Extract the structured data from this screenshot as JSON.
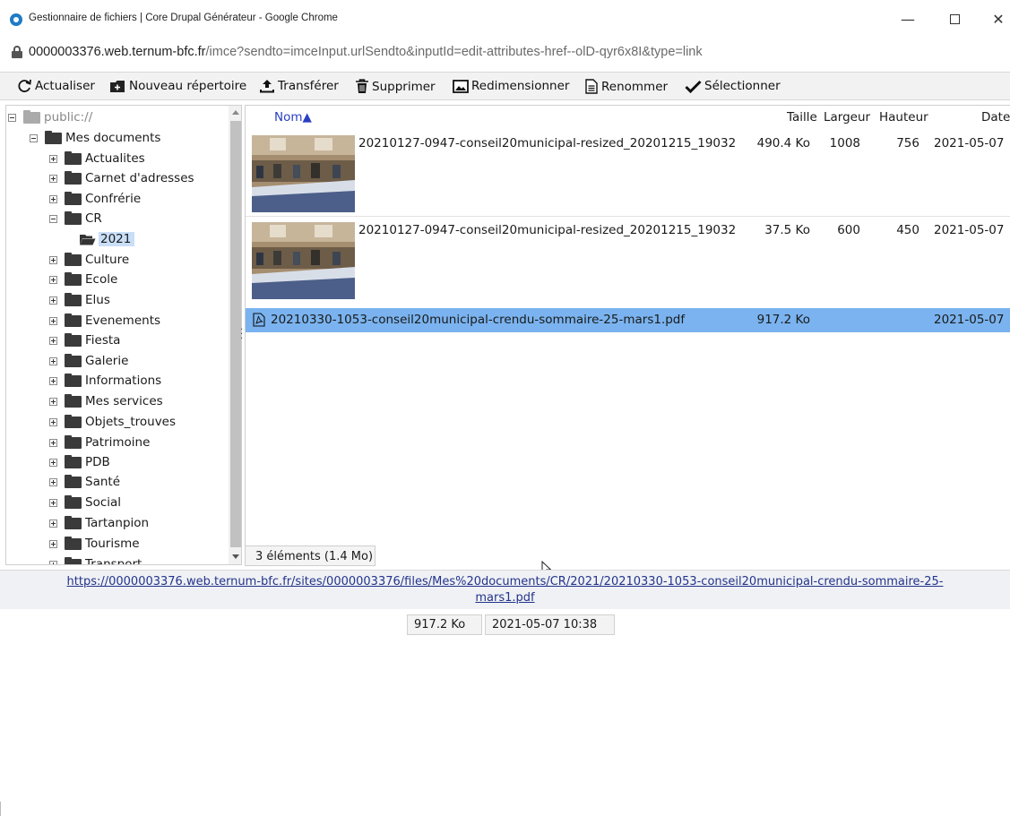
{
  "window": {
    "title": "Gestionnaire de fichiers | Core Drupal Générateur - Google Chrome",
    "min_glyph": "—",
    "close_glyph": "✕"
  },
  "address": {
    "host": "0000003376.web.ternum-bfc.fr",
    "path": "/imce?sendto=imceInput.urlSendto&inputId=edit-attributes-href--olD-qyr6x8I&type=link"
  },
  "toolbar": {
    "refresh": "Actualiser",
    "new_folder": "Nouveau répertoire",
    "upload": "Transférer",
    "delete": "Supprimer",
    "resize": "Redimensionner",
    "rename": "Renommer",
    "select": "Sélectionner"
  },
  "tree": {
    "root": "public://",
    "my_documents": "Mes documents",
    "folders": [
      "Actualites",
      "Carnet d'adresses",
      "Confrérie",
      "CR",
      "2021",
      "Culture",
      "Ecole",
      "Elus",
      "Evenements",
      "Fiesta",
      "Galerie",
      "Informations",
      "Mes services",
      "Objets_trouves",
      "Patrimoine",
      "PDB",
      "Santé",
      "Social",
      "Tartanpion",
      "Tourisme",
      "Transport"
    ]
  },
  "files": {
    "columns": {
      "name": "Nom▲",
      "size": "Taille",
      "width": "Largeur",
      "height": "Hauteur",
      "date": "Date"
    },
    "rows": [
      {
        "name": "20210127-0947-conseil20municipal-resized_20201215_19032",
        "size": "490.4 Ko",
        "width": "1008",
        "height": "756",
        "date": "2021-05-07"
      },
      {
        "name": "20210127-0947-conseil20municipal-resized_20201215_19032",
        "size": "37.5 Ko",
        "width": "600",
        "height": "450",
        "date": "2021-05-07"
      },
      {
        "name": "20210330-1053-conseil20municipal-crendu-sommaire-25-mars1.pdf",
        "size": "917.2 Ko",
        "width": "",
        "height": "",
        "date": "2021-05-07"
      }
    ],
    "status": "3 éléments (1.4 Mo)"
  },
  "preview": {
    "url_line1": "https://0000003376.web.ternum-bfc.fr/sites/0000003376/files/Mes%20documents/CR/2021/20210330-1053-conseil20municipal-crendu-sommaire-25-",
    "url_line2": "mars1.pdf",
    "size": "917.2 Ko",
    "date": "2021-05-07 10:38"
  },
  "splitter": {
    "handle": "..."
  }
}
